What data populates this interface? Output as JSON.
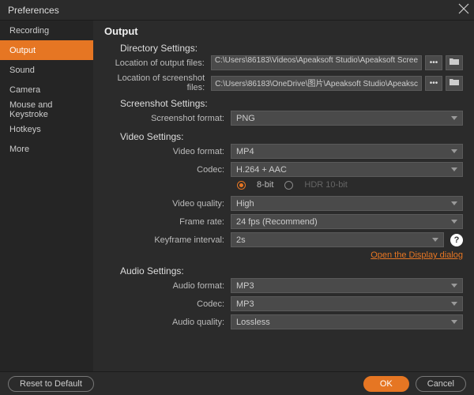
{
  "window": {
    "title": "Preferences"
  },
  "sidebar": {
    "items": [
      {
        "label": "Recording"
      },
      {
        "label": "Output"
      },
      {
        "label": "Sound"
      },
      {
        "label": "Camera"
      },
      {
        "label": "Mouse and Keystroke"
      },
      {
        "label": "Hotkeys"
      },
      {
        "label": "More"
      }
    ],
    "active_index": 1
  },
  "heading": "Output",
  "sections": {
    "directory": {
      "title": "Directory Settings:",
      "output_label": "Location of output files:",
      "output_path": "C:\\Users\\86183\\Videos\\Apeaksoft Studio\\Apeaksoft Scree",
      "screenshot_label": "Location of screenshot files:",
      "screenshot_path": "C:\\Users\\86183\\OneDrive\\图片\\Apeaksoft Studio\\Apeaksc"
    },
    "screenshot": {
      "title": "Screenshot Settings:",
      "format_label": "Screenshot format:",
      "format_value": "PNG"
    },
    "video": {
      "title": "Video Settings:",
      "format_label": "Video format:",
      "format_value": "MP4",
      "codec_label": "Codec:",
      "codec_value": "H.264 + AAC",
      "bitdepth_8": "8-bit",
      "bitdepth_hdr": "HDR 10-bit",
      "quality_label": "Video quality:",
      "quality_value": "High",
      "frame_label": "Frame rate:",
      "frame_value": "24 fps (Recommend)",
      "keyframe_label": "Keyframe interval:",
      "keyframe_value": "2s",
      "link": "Open the Display dialog"
    },
    "audio": {
      "title": "Audio Settings:",
      "format_label": "Audio format:",
      "format_value": "MP3",
      "codec_label": "Codec:",
      "codec_value": "MP3",
      "quality_label": "Audio quality:",
      "quality_value": "Lossless"
    }
  },
  "footer": {
    "reset": "Reset to Default",
    "ok": "OK",
    "cancel": "Cancel"
  },
  "icons": {
    "more": "•••",
    "help": "?"
  }
}
